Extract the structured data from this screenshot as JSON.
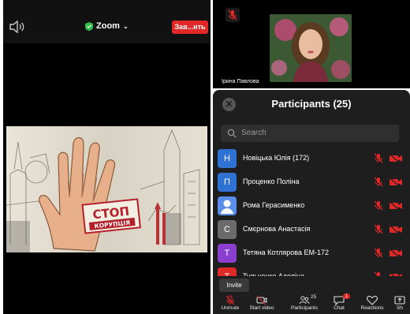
{
  "left": {
    "zoom_label": "Zoom",
    "leave_label": "Зав...ить",
    "share_text_top": "СТОП",
    "share_text_bottom": "КОРУПЦІЯ"
  },
  "right": {
    "video_name": "Ірина Павлова",
    "panel_title": "Participants (25)",
    "search_placeholder": "Search",
    "participants": [
      {
        "initial": "Н",
        "name": "Новіцька Юлія (172)",
        "color": "#2f72d6"
      },
      {
        "initial": "П",
        "name": "Проценко Поліна",
        "color": "#2f72d6"
      },
      {
        "initial": "",
        "name": "Рома Герасименко",
        "color": "#5a8ee8"
      },
      {
        "initial": "С",
        "name": "Смєрнова Анастасія",
        "color": "#6b6b6b"
      },
      {
        "initial": "Т",
        "name": "Тетяна Котлярова ЕМ-172",
        "color": "#8b3fd1"
      },
      {
        "initial": "Т",
        "name": "Тульченко Аделіна",
        "color": "#e02828"
      }
    ],
    "invite_label": "Invite",
    "toolbar": {
      "unmute": "Unmute",
      "start_video": "Start video",
      "participants": "Participants",
      "participants_count": "25",
      "chat": "Chat",
      "chat_badge": "1",
      "reactions": "Reactions",
      "share": "Sh"
    }
  },
  "colors": {
    "leave": "#e02828",
    "muted": "#e02828",
    "shield": "#2fbf4a"
  }
}
